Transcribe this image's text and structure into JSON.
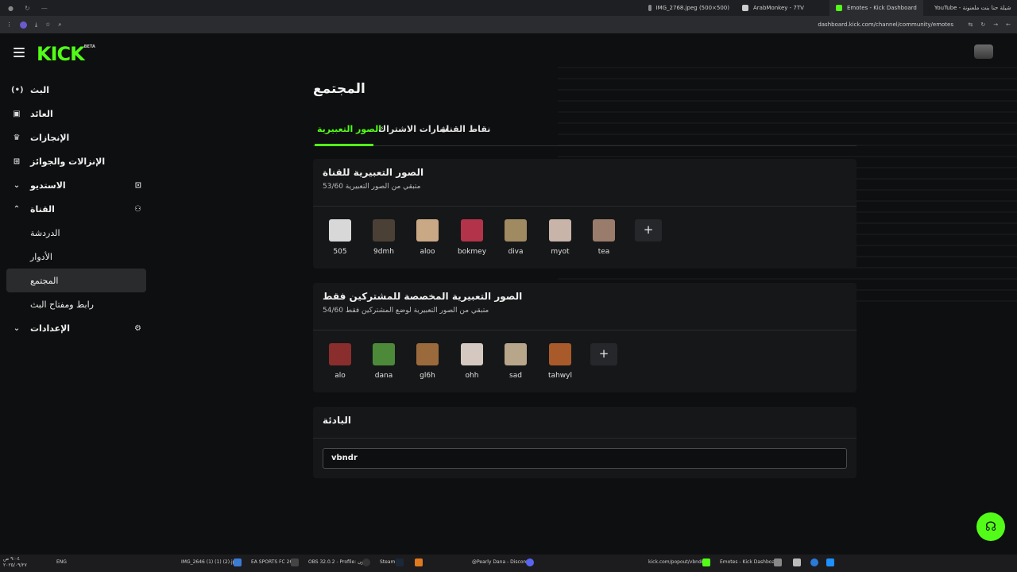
{
  "browser": {
    "tabs": [
      {
        "label": "IMG_2768.jpeg (500×500)",
        "color": "#888888"
      },
      {
        "label": "ArabMonkey - 7TV",
        "color": "#cccccc"
      },
      {
        "label": "Emotes - Kick Dashboard",
        "color": "#53fc18"
      },
      {
        "label": "YouTube - شيلة حنا بنت ملعنونة",
        "color": "#ff0000"
      }
    ],
    "url": "dashboard.kick.com/channel/community/emotes"
  },
  "logo": {
    "text": "KICK",
    "badge": "BETA"
  },
  "sidebar": {
    "items": [
      {
        "label": "البث",
        "icon": "(•)"
      },
      {
        "label": "العائد",
        "icon": "▣"
      },
      {
        "label": "الإنجازات",
        "icon": "🏆"
      },
      {
        "label": "الإنزالات والجوائز",
        "icon": "⊞"
      },
      {
        "label": "الاستديو",
        "icon": "⌄",
        "right_icon": "⊡"
      },
      {
        "label": "القناة",
        "icon": "⌃",
        "right_icon": "⚇"
      },
      {
        "label": "الدردشة"
      },
      {
        "label": "الأدوار"
      },
      {
        "label": "المجتمع"
      },
      {
        "label": "رابط ومفتاح البث"
      },
      {
        "label": "الإعدادات",
        "icon": "⌄",
        "right_icon": "⚙"
      }
    ]
  },
  "main": {
    "title": "المجتمع",
    "tabs": [
      "الصور التعبيرية",
      "شارات الاشتراك",
      "نقاط القناة"
    ]
  },
  "channel_emotes": {
    "title": "الصور التعبيرية للقناة",
    "subtitle": "متبقي من الصور التعبيرية 53/60",
    "items": [
      {
        "name": "505",
        "color": "#d8d8d8"
      },
      {
        "name": "9dmh",
        "color": "#4a4036"
      },
      {
        "name": "aloo",
        "color": "#c9a886"
      },
      {
        "name": "bokmey",
        "color": "#b3334a"
      },
      {
        "name": "diva",
        "color": "#a08a62"
      },
      {
        "name": "myot",
        "color": "#c8b4a8"
      },
      {
        "name": "tea",
        "color": "#9a7c6c"
      }
    ],
    "add_label": "+"
  },
  "sub_emotes": {
    "title": "الصور التعبيرية المخصصة للمشتركين فقط",
    "subtitle": "متبقي من الصور التعبيرية لوضع المشتركين فقط 54/60",
    "items": [
      {
        "name": "alo",
        "color": "#8a2d2d"
      },
      {
        "name": "dana",
        "color": "#4c8a3a"
      },
      {
        "name": "gl6h",
        "color": "#9a6a3c"
      },
      {
        "name": "ohh",
        "color": "#d4c8c0"
      },
      {
        "name": "sad",
        "color": "#b8a68a"
      },
      {
        "name": "tahwyl",
        "color": "#a85a2a"
      }
    ],
    "add_label": "+"
  },
  "prefix": {
    "title": "البادئة",
    "value": "vbndr"
  },
  "taskbar": {
    "time": "٩:٠٤ ص",
    "date": "٢٠٢٥/٠٩/٢٧",
    "lang": "ENG",
    "items": [
      {
        "label": "IMG_2646 (1) (1) (2).jpg"
      },
      {
        "label": "EA SPORTS FC 26"
      },
      {
        "label": "OBS 32.0.2 - Profile: بدون"
      },
      {
        "label": "Steam"
      },
      {
        "label": "@Pearly Dana - Discord"
      },
      {
        "label": "kick.com/popout/vbndr"
      },
      {
        "label": "Emotes - Kick Dashboar"
      }
    ]
  }
}
